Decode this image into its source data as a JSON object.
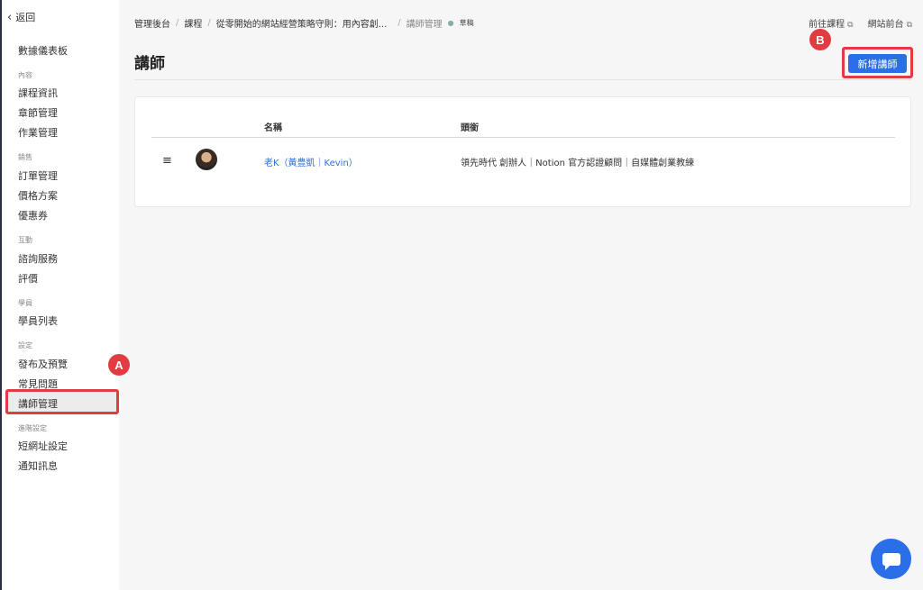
{
  "sidebar": {
    "back_label": "返回",
    "items": [
      {
        "type": "item",
        "label": "數據儀表板"
      },
      {
        "type": "group",
        "label": "內容"
      },
      {
        "type": "item",
        "label": "課程資訊"
      },
      {
        "type": "item",
        "label": "章節管理"
      },
      {
        "type": "item",
        "label": "作業管理"
      },
      {
        "type": "group",
        "label": "銷售"
      },
      {
        "type": "item",
        "label": "訂單管理"
      },
      {
        "type": "item",
        "label": "價格方案"
      },
      {
        "type": "item",
        "label": "優惠券"
      },
      {
        "type": "group",
        "label": "互動"
      },
      {
        "type": "item",
        "label": "諮詢服務"
      },
      {
        "type": "item",
        "label": "評價"
      },
      {
        "type": "group",
        "label": "學員"
      },
      {
        "type": "item",
        "label": "學員列表"
      },
      {
        "type": "group",
        "label": "設定"
      },
      {
        "type": "item",
        "label": "發布及預覽"
      },
      {
        "type": "item",
        "label": "常見問題"
      },
      {
        "type": "item",
        "label": "講師管理",
        "active": true
      },
      {
        "type": "group",
        "label": "進階設定"
      },
      {
        "type": "item",
        "label": "短網址設定"
      },
      {
        "type": "item",
        "label": "通知訊息"
      }
    ]
  },
  "breadcrumb": {
    "items": [
      "管理後台",
      "課程",
      "從零開始的網站經營策略守則：用內容創...",
      "講師管理"
    ],
    "status": "草稿"
  },
  "toplinks": {
    "go_course": "前往課程",
    "site_front": "網站前台"
  },
  "page_title": "講師",
  "add_button": "新增講師",
  "table": {
    "headers": [
      "名稱",
      "頭銜"
    ],
    "rows": [
      {
        "name": "老K（黃豊凱｜Kevin）",
        "headline": "領先時代 創辦人｜Notion 官方認證顧問｜自媒體創業教練"
      }
    ]
  },
  "markers": [
    "A",
    "B"
  ],
  "colors": {
    "accent": "#2b6fe8",
    "highlight": "#e23b42"
  }
}
